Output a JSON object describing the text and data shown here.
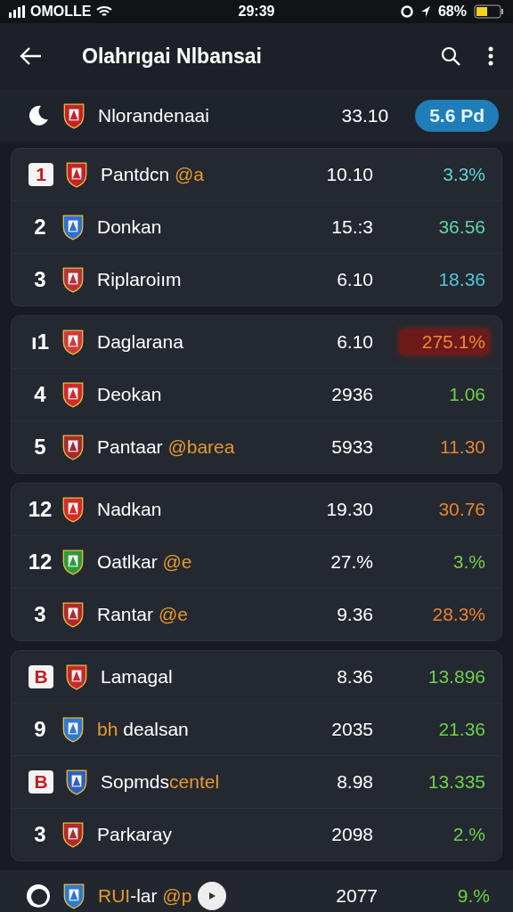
{
  "status_bar": {
    "carrier": "OMOLLE",
    "time": "29:39",
    "battery": "68%"
  },
  "app_bar": {
    "title": "Olahrıgai Nlbansai"
  },
  "top_row": {
    "name": "Nlorandenaai",
    "value": "33.10",
    "badge": "5.6 Pd",
    "crest": {
      "color": "#c8202a"
    }
  },
  "groups": [
    {
      "rows": [
        {
          "rank": "1",
          "kind": "badge",
          "crest": {
            "color": "#c8202a"
          },
          "name": [
            {
              "text": "Pantdcn ",
              "accent": false
            },
            {
              "text": "@a",
              "accent": true
            }
          ],
          "value": "10.10",
          "change": {
            "text": "3.3%",
            "color": "#5fd3d6"
          },
          "highlight": false
        },
        {
          "rank": "2",
          "kind": "plain",
          "crest": {
            "color": "#2f6fd0"
          },
          "name": [
            {
              "text": "Donkan",
              "accent": false
            }
          ],
          "value": "15.:3",
          "change": {
            "text": "36.56",
            "color": "#5fd6a0"
          },
          "highlight": false
        },
        {
          "rank": "3",
          "kind": "plain",
          "crest": {
            "color": "#b8323a"
          },
          "name": [
            {
              "text": "Riplaroiım",
              "accent": false
            }
          ],
          "value": "6.10",
          "change": {
            "text": "18.36",
            "color": "#4fc9dc"
          },
          "highlight": false
        }
      ]
    },
    {
      "rows": [
        {
          "rank": "ı1",
          "kind": "plain",
          "crest": {
            "color": "#d03a3a"
          },
          "name": [
            {
              "text": "Daglarana",
              "accent": false
            }
          ],
          "value": "6.10",
          "change": {
            "text": "275.1%",
            "color": "#f0873a"
          },
          "highlight": true
        },
        {
          "rank": "4",
          "kind": "plain",
          "crest": {
            "color": "#d22a2a"
          },
          "name": [
            {
              "text": "Deokan",
              "accent": false
            }
          ],
          "value": "2936",
          "change": {
            "text": "1.06",
            "color": "#6ed04a"
          },
          "highlight": false
        },
        {
          "rank": "5",
          "kind": "plain",
          "crest": {
            "color": "#a8282e"
          },
          "name": [
            {
              "text": "Pantaar ",
              "accent": false
            },
            {
              "text": "@barea",
              "accent": true
            }
          ],
          "value": "5933",
          "change": {
            "text": "11.30",
            "color": "#e8842e"
          },
          "highlight": false
        }
      ]
    },
    {
      "rows": [
        {
          "rank": "12",
          "kind": "plain",
          "crest": {
            "color": "#d42a2a"
          },
          "name": [
            {
              "text": "Nadkan",
              "accent": false
            }
          ],
          "value": "19.30",
          "change": {
            "text": "30.76",
            "color": "#e8842e"
          },
          "highlight": false
        },
        {
          "rank": "12",
          "kind": "plain",
          "crest": {
            "color": "#2f9a3a"
          },
          "name": [
            {
              "text": "Oatlkar ",
              "accent": false
            },
            {
              "text": "@e",
              "accent": true
            }
          ],
          "value": "27.%",
          "change": {
            "text": "3.%",
            "color": "#6ed04a"
          },
          "highlight": false
        },
        {
          "rank": "3",
          "kind": "plain",
          "crest": {
            "color": "#b42828"
          },
          "name": [
            {
              "text": "Rantar ",
              "accent": false
            },
            {
              "text": "@e",
              "accent": true
            }
          ],
          "value": "9.36",
          "change": {
            "text": "28.3%",
            "color": "#e8842e"
          },
          "highlight": false
        }
      ]
    },
    {
      "rows": [
        {
          "rank": "B",
          "kind": "badge",
          "crest": {
            "color": "#c8282a"
          },
          "name": [
            {
              "text": "Lamagal",
              "accent": false
            }
          ],
          "value": "8.36",
          "change": {
            "text": "13.896",
            "color": "#6ed04a"
          },
          "highlight": false
        },
        {
          "rank": "9",
          "kind": "plain",
          "crest": {
            "color": "#2f78d0"
          },
          "name": [
            {
              "text": "bh ",
              "accent": true
            },
            {
              "text": "dealsan",
              "accent": false
            }
          ],
          "value": "2035",
          "change": {
            "text": "21.36",
            "color": "#6ed04a"
          },
          "highlight": false
        },
        {
          "rank": "B",
          "kind": "badge",
          "crest": {
            "color": "#2f5fc0"
          },
          "name": [
            {
              "text": "Sopmds",
              "accent": false
            },
            {
              "text": "centel",
              "accent": true
            }
          ],
          "value": "8.98",
          "change": {
            "text": "13.335",
            "color": "#6ed04a"
          },
          "highlight": false
        },
        {
          "rank": "3",
          "kind": "plain",
          "crest": {
            "color": "#b42828"
          },
          "name": [
            {
              "text": "Parkaray",
              "accent": false
            }
          ],
          "value": "2098",
          "change": {
            "text": "2.%",
            "color": "#6ed04a"
          },
          "highlight": false
        }
      ]
    }
  ],
  "footer_row": {
    "crest": {
      "color": "#2a7ad0"
    },
    "name": [
      {
        "text": "RUI",
        "accent": true
      },
      {
        "text": "-lar ",
        "accent": false
      },
      {
        "text": "@p",
        "accent": true
      }
    ],
    "value": "2077",
    "change": {
      "text": "9.%",
      "color": "#6ed04a"
    }
  }
}
